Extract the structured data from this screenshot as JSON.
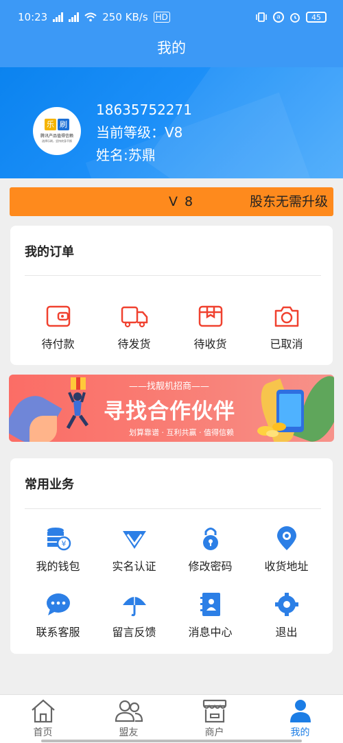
{
  "status_bar": {
    "time": "10:23",
    "net1": "4G",
    "net2": "2G",
    "speed": "250 KB/s",
    "hd": "HD",
    "battery": "45"
  },
  "header": {
    "title": "我的"
  },
  "profile": {
    "phone": "18635752271",
    "level": "当前等级：V8",
    "name": "姓名:苏鼎",
    "avatar": {
      "logo_char_1": "乐",
      "logo_char_2": "刷",
      "tagline": "腾讯产品值得信赖",
      "subline": "选择乐刷，坚持终身不换"
    }
  },
  "level_banner": {
    "level": "V 8",
    "note": "股东无需升级"
  },
  "orders": {
    "title": "我的订单",
    "items": [
      {
        "label": "待付款",
        "icon": "wallet-icon"
      },
      {
        "label": "待发货",
        "icon": "truck-icon"
      },
      {
        "label": "待收货",
        "icon": "package-icon"
      },
      {
        "label": "已取消",
        "icon": "camera-icon"
      }
    ],
    "accent": "#f0412f"
  },
  "promo": {
    "top_line": "——找靓机招商——",
    "headline": "寻找合作伙伴",
    "sub_line": "划算靠谱 · 互利共赢 · 值得信赖"
  },
  "services": {
    "title": "常用业务",
    "items": [
      {
        "label": "我的钱包",
        "icon": "wallet-coins-icon"
      },
      {
        "label": "实名认证",
        "icon": "diamond-v-icon"
      },
      {
        "label": "修改密码",
        "icon": "lock-icon"
      },
      {
        "label": "收货地址",
        "icon": "location-pin-icon"
      },
      {
        "label": "联系客服",
        "icon": "chat-bubble-icon"
      },
      {
        "label": "留言反馈",
        "icon": "umbrella-icon"
      },
      {
        "label": "消息中心",
        "icon": "contact-book-icon"
      },
      {
        "label": "退出",
        "icon": "exit-gear-icon"
      }
    ],
    "accent": "#2c7fe6"
  },
  "bottom_nav": {
    "items": [
      {
        "label": "首页",
        "icon": "home-icon"
      },
      {
        "label": "盟友",
        "icon": "users-icon"
      },
      {
        "label": "商户",
        "icon": "store-icon"
      },
      {
        "label": "我的",
        "icon": "person-icon"
      }
    ],
    "active_index": 3,
    "active_color": "#1c7de5"
  }
}
